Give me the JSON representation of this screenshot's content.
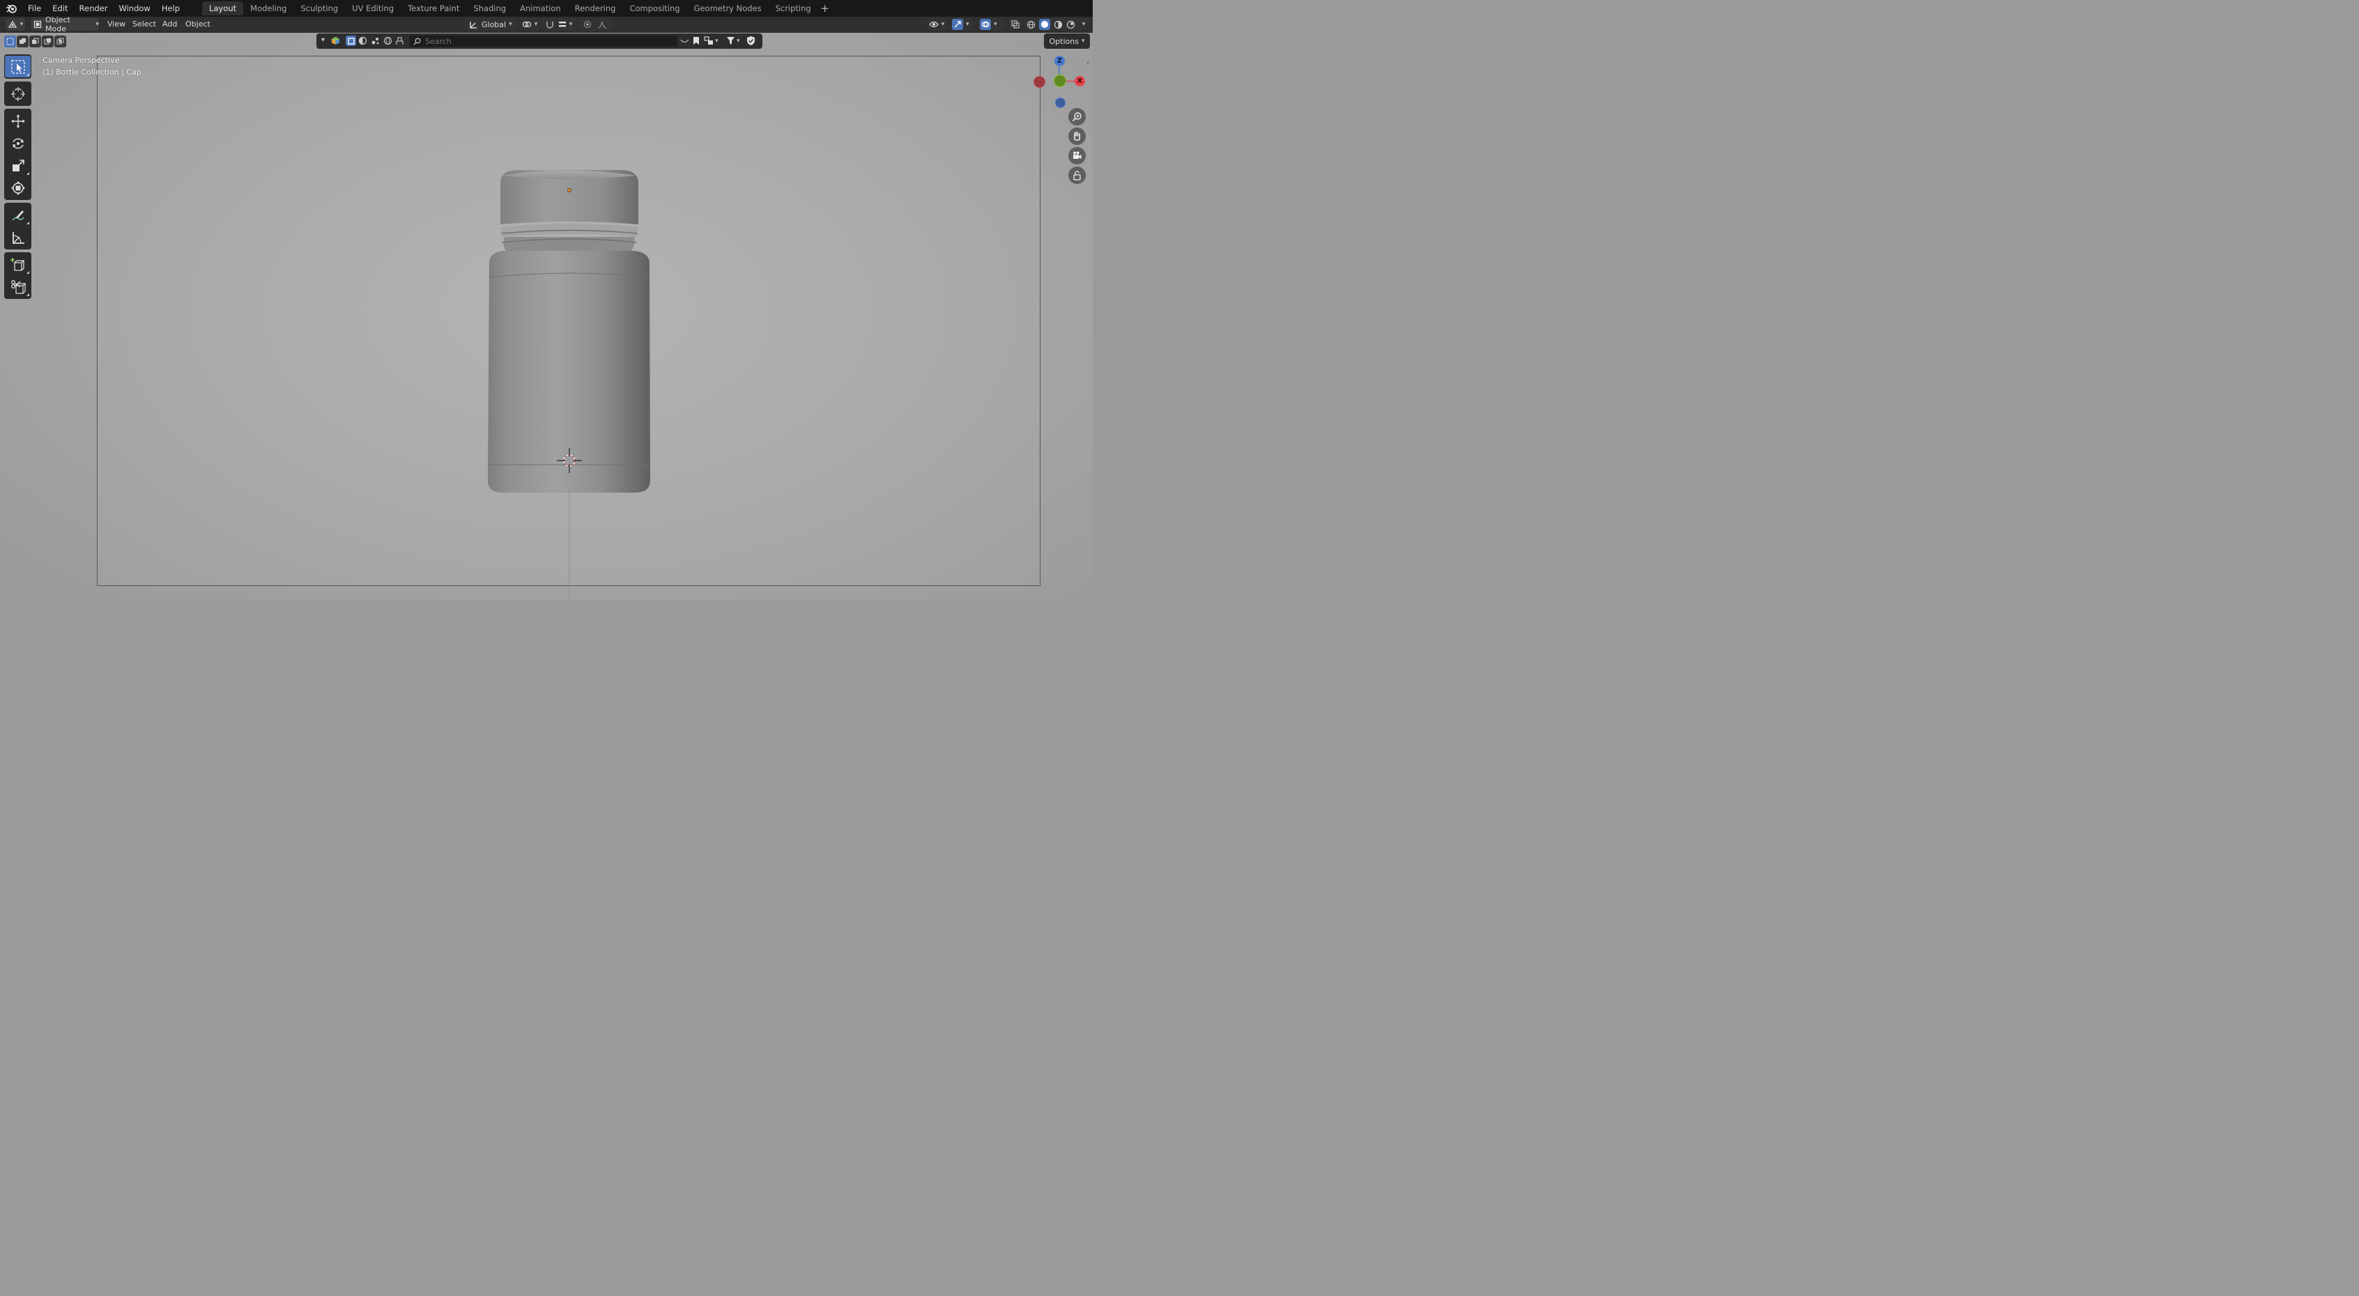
{
  "app": {
    "logo_icon": "blender-logo-icon"
  },
  "menu": [
    "File",
    "Edit",
    "Render",
    "Window",
    "Help"
  ],
  "workspaces": {
    "tabs": [
      "Layout",
      "Modeling",
      "Sculpting",
      "UV Editing",
      "Texture Paint",
      "Shading",
      "Animation",
      "Rendering",
      "Compositing",
      "Geometry Nodes",
      "Scripting"
    ],
    "active": "Layout",
    "add_label": "+"
  },
  "header": {
    "mode": "Object Mode",
    "menus": [
      "View",
      "Select",
      "Add",
      "Object"
    ],
    "transform_orientation": "Global"
  },
  "viewport_header": {
    "search_placeholder": "Search",
    "options_label": "Options"
  },
  "viewport": {
    "camera_label": "Camera Perspective",
    "collection_label": "(1) Bottle Collection | Cap"
  },
  "gizmo": {
    "x": "X",
    "y": "",
    "z": "Z"
  },
  "colors": {
    "accent": "#4b74b7",
    "topbar": "#181818",
    "header": "#303030",
    "axis_x": "#e5434b",
    "axis_y": "#8cba2f",
    "axis_z": "#4a7ad0",
    "origin": "#f08a20"
  }
}
